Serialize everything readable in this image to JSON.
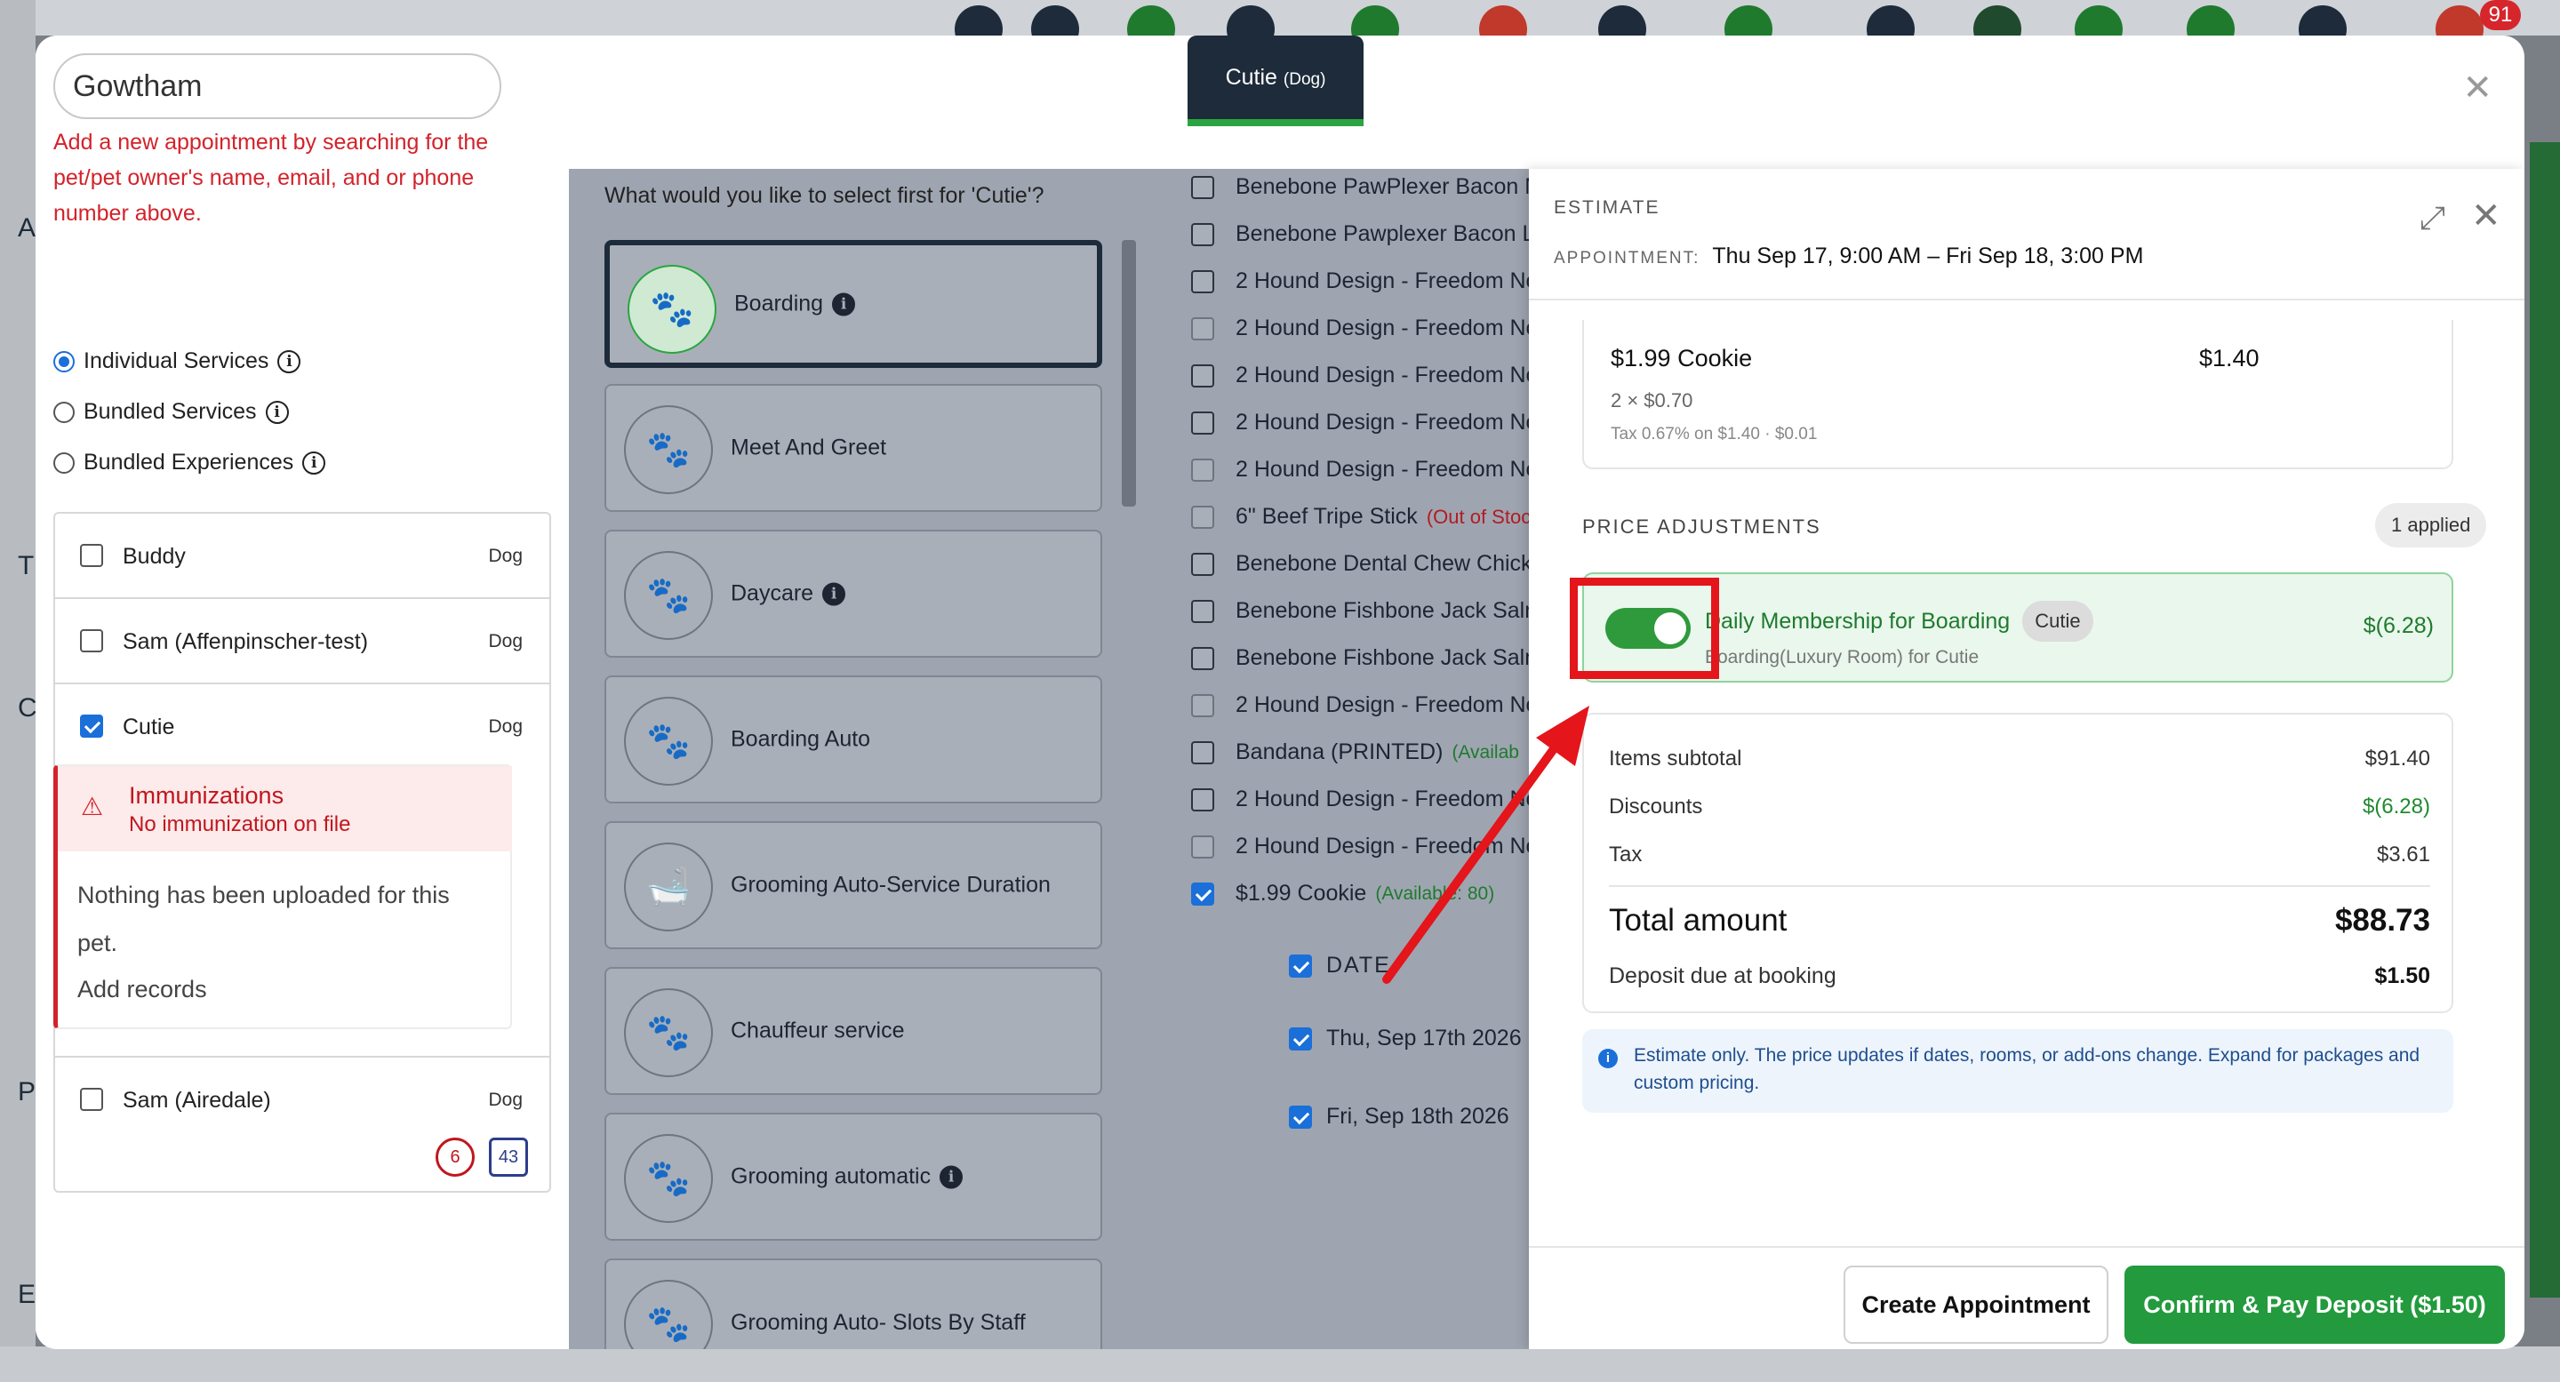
{
  "background": {
    "notification_count": "91",
    "left_letters": [
      "A",
      "T",
      "C",
      "P",
      "E"
    ]
  },
  "search": {
    "value": "Gowtham",
    "hint": "Add a new appointment by searching for the pet/pet owner's name, email, and or phone number above."
  },
  "service_types": [
    {
      "label": "Individual Services",
      "selected": true
    },
    {
      "label": "Bundled Services",
      "selected": false
    },
    {
      "label": "Bundled Experiences",
      "selected": false
    }
  ],
  "pets": [
    {
      "name": "Buddy",
      "species": "Dog",
      "checked": false
    },
    {
      "name": "Sam (Affenpinscher-test)",
      "species": "Dog",
      "checked": false
    },
    {
      "name": "Cutie",
      "species": "Dog",
      "checked": true
    },
    {
      "name": "Sam (Airedale)",
      "species": "Dog",
      "checked": false
    }
  ],
  "immunizations": {
    "title": "Immunizations",
    "subtitle": "No immunization on file",
    "body": "Nothing has been uploaded for this pet.",
    "link": "Add records"
  },
  "pet_counters": {
    "left": "6",
    "right": "43"
  },
  "pet_tab": {
    "name": "Cutie",
    "species": "(Dog)"
  },
  "services": {
    "question": "What would you like to select first for 'Cutie'?",
    "items": [
      {
        "label": "Boarding",
        "info": true,
        "selected": true
      },
      {
        "label": "Meet And Greet",
        "info": false
      },
      {
        "label": "Daycare",
        "info": true
      },
      {
        "label": "Boarding Auto",
        "info": false
      },
      {
        "label": "Grooming Auto-Service Duration",
        "info": false
      },
      {
        "label": "Chauffeur service",
        "info": false
      },
      {
        "label": "Grooming automatic",
        "info": true
      },
      {
        "label": "Grooming Auto- Slots By Staff",
        "info": false
      }
    ]
  },
  "products": [
    {
      "name": "Benebone PawPlexer Bacon M",
      "checked": false
    },
    {
      "name": "Benebone Pawplexer Bacon La",
      "checked": false
    },
    {
      "name": "2 Hound Design - Freedom No",
      "checked": false
    },
    {
      "name": "2 Hound Design - Freedom No",
      "checked": false
    },
    {
      "name": "2 Hound Design - Freedom No",
      "checked": false
    },
    {
      "name": "2 Hound Design - Freedom No",
      "checked": false
    },
    {
      "name": "2 Hound Design - Freedom No",
      "checked": false
    },
    {
      "name": "6\" Beef Tripe Stick",
      "status": "(Out of Stoc",
      "checked": false
    },
    {
      "name": "Benebone Dental Chew Chicke",
      "checked": false
    },
    {
      "name": "Benebone Fishbone Jack Salm",
      "checked": false
    },
    {
      "name": "Benebone Fishbone Jack Salm",
      "checked": false
    },
    {
      "name": "2 Hound Design - Freedom No",
      "checked": false
    },
    {
      "name": "Bandana (PRINTED)",
      "avail": "(Availab",
      "checked": false
    },
    {
      "name": "2 Hound Design - Freedom No",
      "checked": false
    },
    {
      "name": "2 Hound Design - Freedom No",
      "checked": false
    },
    {
      "name": "$1.99 Cookie",
      "avail": "(Available: 80)",
      "checked": true
    }
  ],
  "dates": {
    "header": "DATE",
    "items": [
      "Thu, Sep 17th 2026",
      "Fri, Sep 18th 2026"
    ]
  },
  "estimate": {
    "label": "ESTIMATE",
    "appointment_key": "APPOINTMENT:",
    "appointment_value": "Thu Sep 17, 9:00 AM – Fri Sep 18, 3:00 PM",
    "line_item": {
      "name": "$1.99 Cookie",
      "price": "$1.40",
      "qty": "2 × $0.70",
      "tax": "Tax 0.67% on $1.40 · $0.01"
    },
    "price_adjustments_label": "PRICE ADJUSTMENTS",
    "applied_badge": "1 applied",
    "adjustment": {
      "title": "Daily Membership for Boarding",
      "pet": "Cutie",
      "subtitle": "Boarding(Luxury Room) for Cutie",
      "amount": "$(6.28)",
      "enabled": true
    },
    "summary": {
      "items_subtotal_label": "Items subtotal",
      "items_subtotal": "$91.40",
      "discounts_label": "Discounts",
      "discounts": "$(6.28)",
      "tax_label": "Tax",
      "tax": "$3.61",
      "total_label": "Total amount",
      "total": "$88.73",
      "deposit_label": "Deposit due at booking",
      "deposit": "$1.50"
    },
    "note": "Estimate only. The price updates if dates, rooms, or add-ons change. Expand for packages and custom pricing.",
    "create_button": "Create Appointment",
    "confirm_button": "Confirm & Pay Deposit ($1.50)"
  },
  "colors": {
    "accent_green": "#229a3d",
    "navy": "#1d2b3a",
    "error_red": "#d3222a",
    "highlight_red": "#e4151b"
  }
}
